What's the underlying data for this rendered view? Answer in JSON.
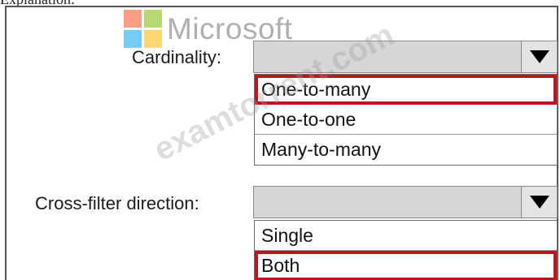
{
  "header_cut_text": "Explanation:",
  "logo": {
    "text": "Microsoft",
    "colors": [
      "#f25022",
      "#7fba00",
      "#00a4ef",
      "#ffb900"
    ]
  },
  "watermark": "examtorrent.com",
  "accent_color": "#c1121f",
  "cardinality": {
    "label": "Cardinality:",
    "value": "",
    "dropdown_icon": "triangle-down-icon",
    "options": [
      {
        "label": "One-to-many",
        "selected": true
      },
      {
        "label": "One-to-one",
        "selected": false
      },
      {
        "label": "Many-to-many",
        "selected": false
      }
    ]
  },
  "cross_filter": {
    "label": "Cross-filter direction:",
    "value": "",
    "dropdown_icon": "triangle-down-icon",
    "options": [
      {
        "label": "Single",
        "selected": false
      },
      {
        "label": "Both",
        "selected": true
      }
    ]
  }
}
